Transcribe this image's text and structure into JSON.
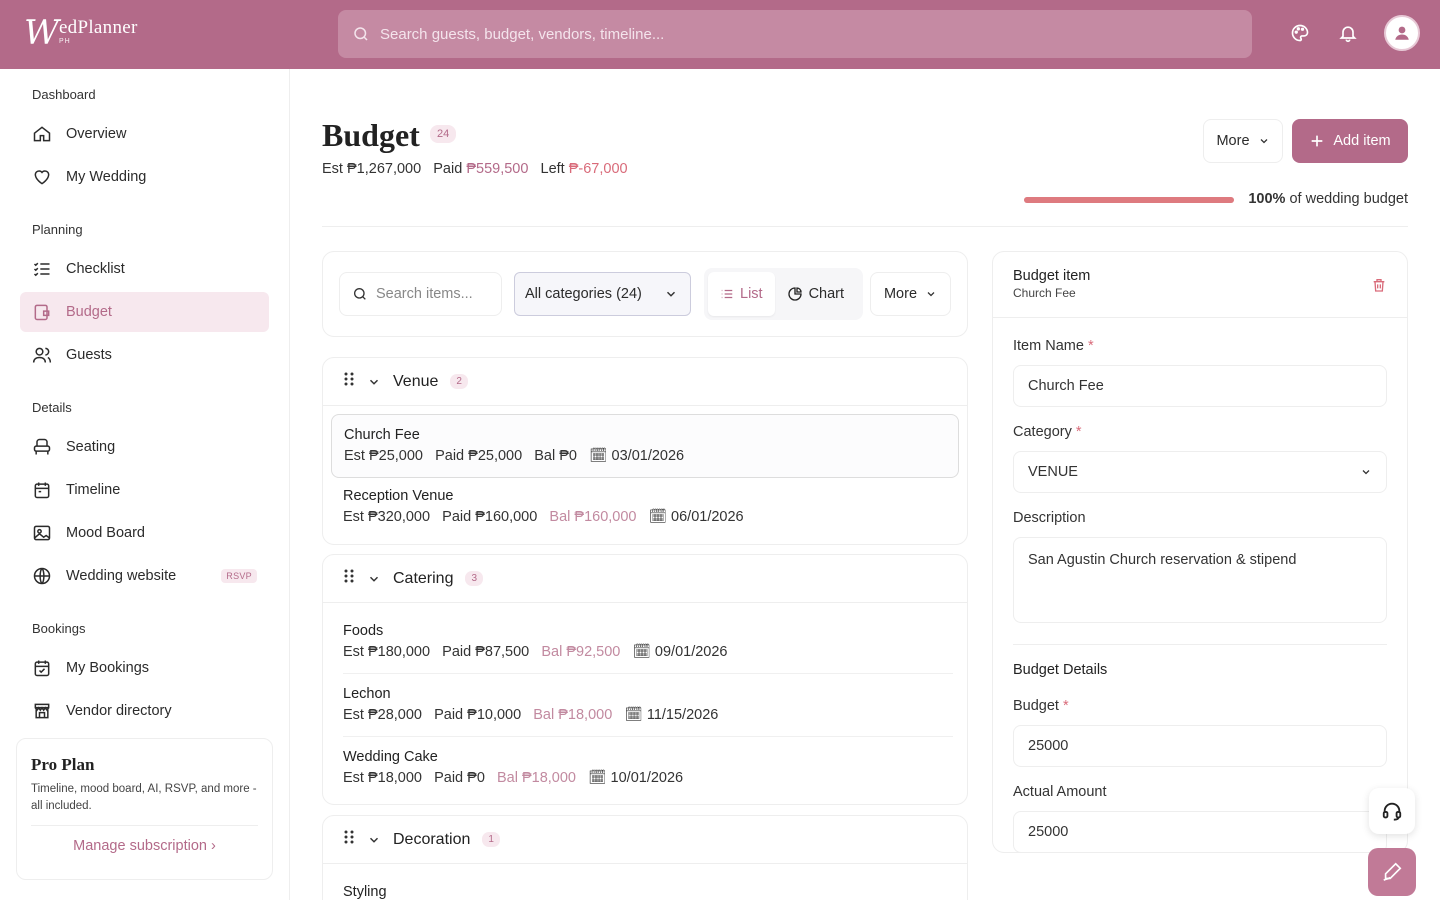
{
  "app": {
    "logo_letter": "W",
    "logo_name": "edPlanner",
    "logo_suffix": "PH"
  },
  "search": {
    "placeholder": "Search guests, budget, vendors, timeline..."
  },
  "sidebar": {
    "sections": [
      "Dashboard",
      "Planning",
      "Details",
      "Bookings"
    ],
    "items": [
      {
        "label": "Overview",
        "icon": "home-icon"
      },
      {
        "label": "My Wedding",
        "icon": "heart-icon"
      },
      {
        "label": "Checklist",
        "icon": "checklist-icon"
      },
      {
        "label": "Budget",
        "icon": "wallet-icon"
      },
      {
        "label": "Guests",
        "icon": "users-icon"
      },
      {
        "label": "Seating",
        "icon": "chair-icon"
      },
      {
        "label": "Timeline",
        "icon": "calendar-icon"
      },
      {
        "label": "Mood Board",
        "icon": "image-icon"
      },
      {
        "label": "Wedding website",
        "icon": "globe-icon",
        "badge": "RSVP"
      },
      {
        "label": "My Bookings",
        "icon": "calendar-check-icon"
      },
      {
        "label": "Vendor directory",
        "icon": "store-icon"
      }
    ],
    "pro": {
      "title": "Pro Plan",
      "desc": "Timeline, mood board, AI, RSVP, and more - all included.",
      "link": "Manage subscription"
    }
  },
  "header": {
    "title": "Budget",
    "count": "24",
    "est_label": "Est",
    "est": "₱1,267,000",
    "paid_label": "Paid",
    "paid": "₱559,500",
    "left_label": "Left",
    "left": "₱-67,000",
    "more": "More",
    "add": "Add item",
    "progress_pct": "100%",
    "progress_text": "of wedding budget",
    "progress_value": 100
  },
  "toolbar": {
    "search_placeholder": "Search items...",
    "category": "All categories (24)",
    "list": "List",
    "chart": "Chart",
    "more": "More"
  },
  "groups": [
    {
      "name": "Venue",
      "count": "2",
      "items": [
        {
          "name": "Church Fee",
          "est": "Est ₱25,000",
          "paid": "Paid ₱25,000",
          "bal": "Bal ₱0",
          "date": "03/01/2026"
        },
        {
          "name": "Reception Venue",
          "est": "Est ₱320,000",
          "paid": "Paid ₱160,000",
          "bal": "Bal ₱160,000",
          "date": "06/01/2026"
        }
      ]
    },
    {
      "name": "Catering",
      "count": "3",
      "items": [
        {
          "name": "Foods",
          "est": "Est ₱180,000",
          "paid": "Paid ₱87,500",
          "bal": "Bal ₱92,500",
          "date": "09/01/2026"
        },
        {
          "name": "Lechon",
          "est": "Est ₱28,000",
          "paid": "Paid ₱10,000",
          "bal": "Bal ₱18,000",
          "date": "11/15/2026"
        },
        {
          "name": "Wedding Cake",
          "est": "Est ₱18,000",
          "paid": "Paid ₱0",
          "bal": "Bal ₱18,000",
          "date": "10/01/2026"
        }
      ]
    },
    {
      "name": "Decoration",
      "count": "1",
      "items": [
        {
          "name": "Styling"
        }
      ]
    }
  ],
  "panel": {
    "title": "Budget item",
    "subtitle": "Church Fee",
    "item_name_label": "Item Name",
    "item_name": "Church Fee",
    "category_label": "Category",
    "category": "VENUE",
    "description_label": "Description",
    "description": "San Agustin Church reservation & stipend",
    "details_heading": "Budget Details",
    "budget_label": "Budget",
    "budget": "25000",
    "actual_label": "Actual Amount",
    "actual": "25000"
  },
  "colors": {
    "brand": "#b36a89",
    "brand_light": "#f7e8ee",
    "negative": "#d96b7a"
  }
}
